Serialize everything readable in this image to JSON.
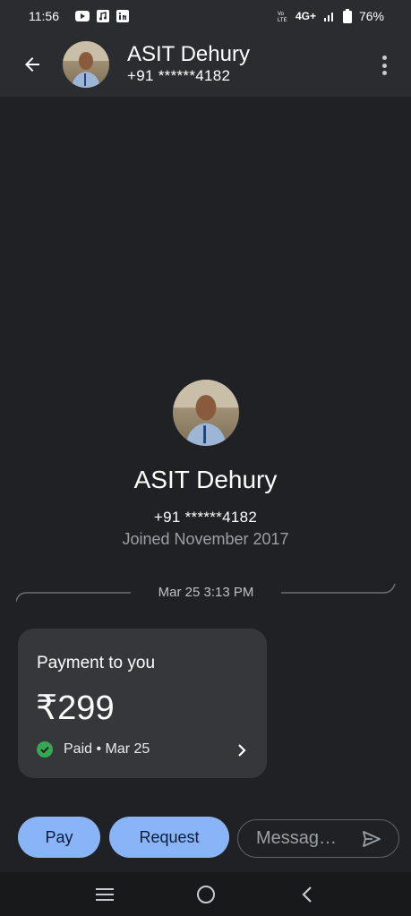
{
  "status_bar": {
    "time": "11:56",
    "network": "4G+",
    "battery": "76%",
    "icons": [
      "youtube-icon",
      "music-icon",
      "linkedin-icon",
      "volte-icon",
      "signal-icon",
      "battery-icon"
    ]
  },
  "header": {
    "name": "ASIT Dehury",
    "phone": "+91 ******4182",
    "back_icon": "arrow-back-icon",
    "more_icon": "more-vert-icon"
  },
  "profile": {
    "name": "ASIT Dehury",
    "phone": "+91 ******4182",
    "joined": "Joined November 2017"
  },
  "conversation": {
    "date_divider": "Mar 25 3:13 PM"
  },
  "payment_card": {
    "title": "Payment to you",
    "amount": "₹299",
    "status": "Paid • Mar 25",
    "status_color": "#34a853"
  },
  "actions": {
    "pay_label": "Pay",
    "request_label": "Request",
    "message_placeholder": "Messag…",
    "accent": "#8ab4f8"
  },
  "nav_bar": {
    "icons": [
      "recents-icon",
      "home-icon",
      "back-nav-icon"
    ]
  }
}
